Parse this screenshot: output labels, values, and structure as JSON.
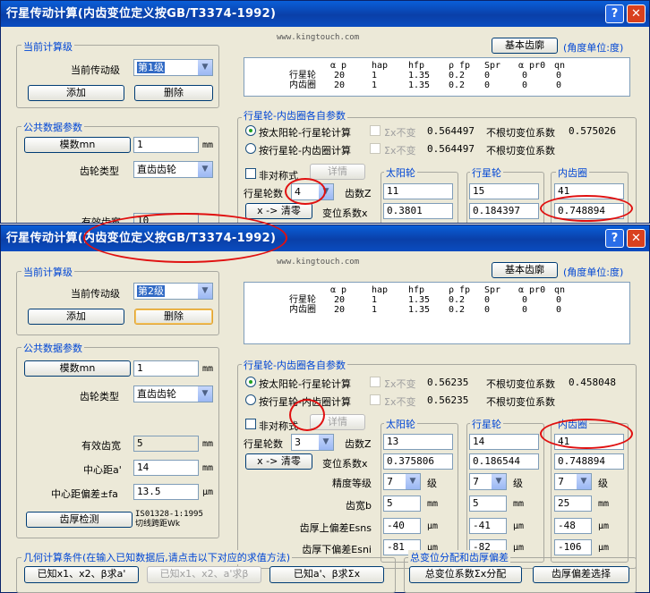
{
  "title": "行星传动计算(内齿变位定义按GB/T3374-1992)",
  "website": "www.kingtouch.com",
  "help_glyph": "?",
  "close_glyph": "✕",
  "basic_profile_btn": "基本齿廓",
  "angle_unit": "(角度单位:度)",
  "current_stage_group": "当前计算级",
  "current_stage_label": "当前传动级",
  "add_btn": "添加",
  "delete_btn": "删除",
  "common_group": "公共数据参数",
  "module_btn": "模数mn",
  "module_value": "1",
  "unit_mm": "mm",
  "unit_um": "μm",
  "gear_type_label": "齿轮类型",
  "gear_type_value": "直齿齿轮",
  "table_headers": [
    "α p",
    "hap",
    "hfp",
    "ρ fp",
    "Spr",
    "α pr0",
    "qn"
  ],
  "table_rows": [
    {
      "name": "行星轮",
      "vals": [
        "20",
        "1",
        "1.35",
        "0.2",
        "0",
        "0",
        "0"
      ]
    },
    {
      "name": "内齿圈",
      "vals": [
        "20",
        "1",
        "1.35",
        "0.2",
        "0",
        "0",
        "0"
      ]
    }
  ],
  "params_group": "行星轮-内齿圈各自参数",
  "radio_sun": "按太阳轮-行星轮计算",
  "radio_ring": "按行星轮-内齿圈计算",
  "sum_x_label": "Σx不变",
  "undercut_label": "不根切变位系数",
  "nonstd_label": "非对称式",
  "detail_btn": "详情",
  "planet_count_label": "行星轮数",
  "teeth_label": "齿数Z",
  "shift_label": "变位系数x",
  "x_clear_btn": "x -> 清零",
  "col_sun": "太阳轮",
  "col_planet": "行星轮",
  "col_ring": "内齿圈",
  "windowA": {
    "stage": "第1级",
    "sumx_sun": "0.564497",
    "sumx_ring": "0.564497",
    "undercut": "0.575026",
    "planets": "4",
    "teeth": [
      "11",
      "15",
      "41"
    ],
    "shift": [
      "0.3801",
      "0.184397",
      "0.748894"
    ],
    "center_label": "有效齿宽",
    "center_value": "10"
  },
  "windowB": {
    "stage": "第2级",
    "sumx_sun": "0.56235",
    "sumx_ring": "0.56235",
    "undercut": "0.458048",
    "planets": "3",
    "teeth": [
      "13",
      "14",
      "41"
    ],
    "shift": [
      "0.375806",
      "0.186544",
      "0.748894"
    ],
    "eff_width_label": "有效齿宽",
    "eff_width": "5",
    "center_dist_label": "中心距a'",
    "center_dist": "14",
    "center_dev_label": "中心距偏差±fa",
    "center_dev": "13.5",
    "thick_btn": "齿厚检测",
    "thick_line1": "IS01328-1:1995",
    "thick_line2": "切线跨距Wk",
    "accuracy_label": "精度等级",
    "accuracy": [
      "7",
      "7",
      "7"
    ],
    "grade_unit": "级",
    "face_width_label": "齿宽b",
    "face_width": [
      "5",
      "5",
      "25"
    ],
    "upper_dev_label": "齿厚上偏差Esns",
    "upper_dev": [
      "-40",
      "-41",
      "-48"
    ],
    "lower_dev_label": "齿厚下偏差Esni",
    "lower_dev": [
      "-81",
      "-82",
      "-106"
    ],
    "geo_group": "几何计算条件(在输入已知数据后,请点击以下对应的求值方法)",
    "geo_btn1": "已知x1、x2、β求a'",
    "geo_btn2": "已知x1、x2、a'求β",
    "geo_btn3": "已知a'、β求Σx",
    "total_group": "总变位分配和齿厚偏差",
    "total_btn": "总变位系数Σx分配",
    "thick_dev_btn": "齿厚偏差选择"
  },
  "accent_color": "#e01010"
}
